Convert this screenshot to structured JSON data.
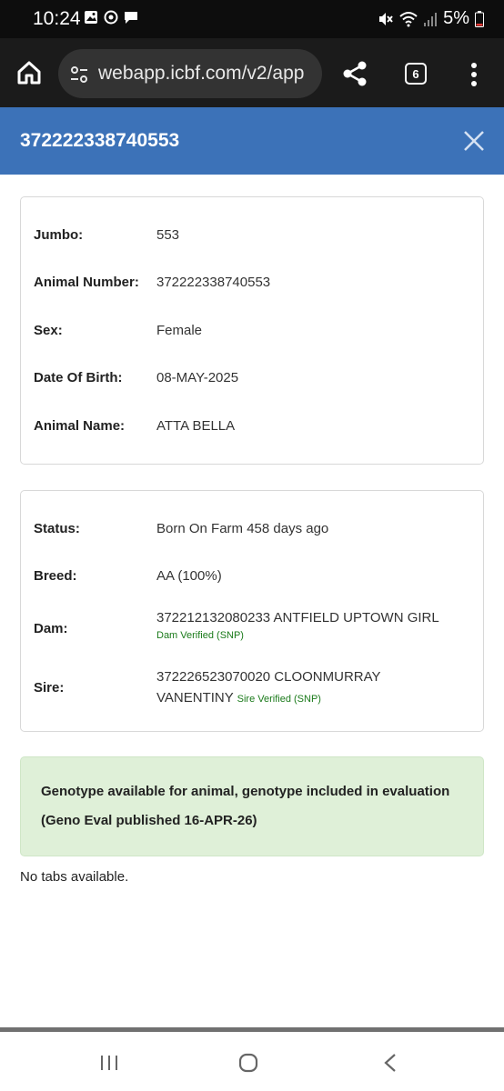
{
  "status_bar": {
    "time": "10:24",
    "battery": "5%",
    "icons_left": [
      "image-icon",
      "sync-icon",
      "message-icon"
    ],
    "icons_right": [
      "mute-icon",
      "wifi-icon",
      "signal-icon",
      "battery-icon"
    ]
  },
  "browser": {
    "url": "webapp.icbf.com/v2/app",
    "tab_count": "6"
  },
  "header": {
    "title": "372222338740553"
  },
  "animal_details": {
    "jumbo_label": "Jumbo:",
    "jumbo_value": "553",
    "animal_number_label": "Animal Number:",
    "animal_number_value": "372222338740553",
    "sex_label": "Sex:",
    "sex_value": "Female",
    "dob_label": "Date Of Birth:",
    "dob_value": "08-MAY-2025",
    "name_label": "Animal Name:",
    "name_value": "ATTA BELLA"
  },
  "lineage": {
    "status_label": "Status:",
    "status_value": "Born On Farm 458 days ago",
    "breed_label": "Breed:",
    "breed_value": "AA (100%)",
    "dam_label": "Dam:",
    "dam_value": "372212132080233 ANTFIELD UPTOWN GIRL",
    "dam_verified": "Dam Verified (SNP)",
    "sire_label": "Sire:",
    "sire_value_line1": "372226523070020 CLOONMURRAY",
    "sire_value_line2": "VANENTINY",
    "sire_verified": "Sire Verified (SNP)"
  },
  "genotype": {
    "line1": "Genotype available for animal, genotype included in evaluation",
    "line2": "(Geno Eval published 16-APR-26)"
  },
  "tabs": {
    "empty_text": "No tabs available."
  },
  "colors": {
    "header_bg": "#3c72b8",
    "genotype_bg": "#dff0d8",
    "verified_text": "#1a7a1a"
  }
}
